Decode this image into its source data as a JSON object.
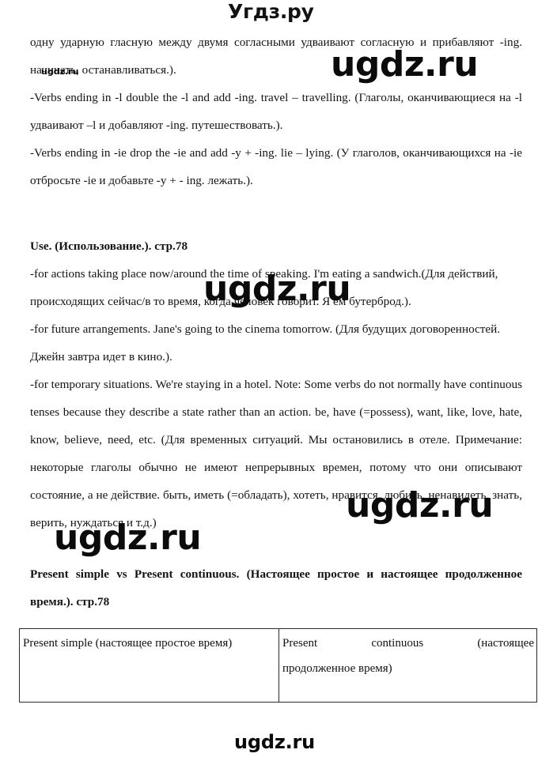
{
  "site": {
    "header_logo": "Угдз.ру",
    "watermark_text": "ugdz.ru"
  },
  "document": {
    "paragraphs": [
      {
        "id": "p1",
        "text": "одну ударную гласную между двумя согласными удваивают согласную и прибавляют -ing. начинать, останавливаться.)."
      },
      {
        "id": "p2",
        "text": "-Verbs ending in -l double the -l and add -ing. travel – travelling. (Глаголы, оканчивающиеся на -l удваивают –l и добавляют -ing. путешествовать.)."
      },
      {
        "id": "p3",
        "text": "-Verbs ending in -ie drop the -ie and add -y + -ing. lie – lying. (У глаголов, оканчивающихся на -ie отбросьте -ie и добавьте -y + - ing. лежать.)."
      }
    ],
    "use_heading": "Use. (Использование.). стр.78",
    "use_items": [
      {
        "id": "u1",
        "text": "-for actions taking place now/around the time of speaking. I'm eating a sandwich.(Для действий, происходящих сейчас/в то время, когда человек говорит. Я ем бутерброд.)."
      },
      {
        "id": "u2",
        "text": "-for future arrangements. Jane's going to the cinema tomorrow. (Для будущих договоренностей. Джейн завтра идет в кино.)."
      },
      {
        "id": "u3",
        "text": "-for temporary situations. We're staying in a hotel. Note: Some verbs do not normally have continuous tenses because they describe a state rather than an action. be, have (=possess), want, like, love, hate, know, believe, need, etc. (Для временных ситуаций. Мы остановились в отеле. Примечание: некоторые глаголы обычно не имеют непрерывных времен, потому что они описывают состояние, а не действие. быть, иметь (=обладать), хотеть, нравится, любить, ненавидеть, знать, верить, нуждаться и т.д.)"
      }
    ],
    "comparison_heading": "Present simple vs Present continuous. (Настоящее простое и настоящее продолженное время.). стр.78"
  },
  "table": {
    "columns": [
      {
        "id": "col-present-simple",
        "header": "Present simple (настоящее простое время)"
      },
      {
        "id": "col-present-continuous",
        "header_line1": "Present continuous (настоящее",
        "header_line2": "продолженное время)"
      }
    ]
  },
  "colors": {
    "text": "#141414",
    "border": "#2b2b2b",
    "watermark": "#0b0b0b",
    "background": "#ffffff"
  }
}
